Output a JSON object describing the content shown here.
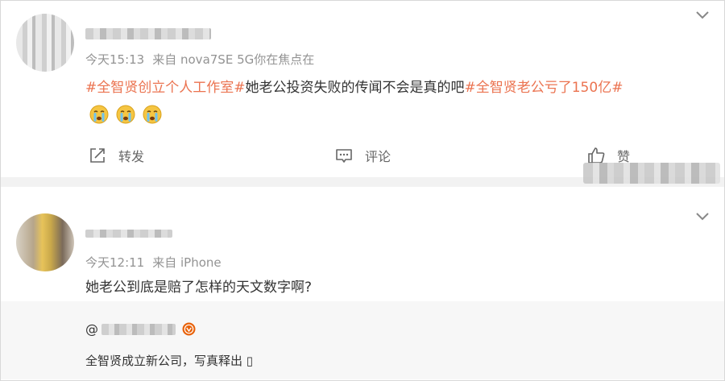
{
  "post1": {
    "time": "今天15:13",
    "source": "来自 nova7SE 5G你在焦点在",
    "content": {
      "tag1": "#全智贤创立个人工作室#",
      "text": "她老公投资失败的传闻不会是真的吧",
      "tag2": "#全智贤老公亏了150亿#"
    },
    "emojis": [
      "crying-face-icon",
      "crying-face-icon",
      "crying-face-icon"
    ],
    "actions": {
      "forward": "转发",
      "comment": "评论",
      "like": "赞"
    }
  },
  "post2": {
    "time": "今天12:11",
    "source": "来自 iPhone",
    "content": "她老公到底是赔了怎样的天文数字啊?",
    "reply": {
      "at": "@",
      "text": "全智贤成立新公司，写真释出 ▯"
    }
  },
  "colors": {
    "accent": "#eb7350",
    "meta": "#939393",
    "text": "#333333",
    "separator": "#f2f2f2",
    "reply_bg": "#f7f7f7",
    "verified": "#e8620a"
  }
}
